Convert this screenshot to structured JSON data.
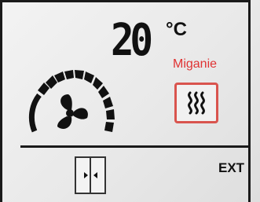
{
  "display": {
    "temperature": "20",
    "unit": "°C",
    "mode_label": "Miganie",
    "ext_label": "EXT"
  },
  "icons": {
    "fan": "fan-icon",
    "fan_speed": "fan-speed-gauge-icon",
    "heat": "heat-waves-icon",
    "door": "double-door-icon"
  },
  "colors": {
    "accent_red": "#e03232",
    "foreground": "#111111"
  }
}
